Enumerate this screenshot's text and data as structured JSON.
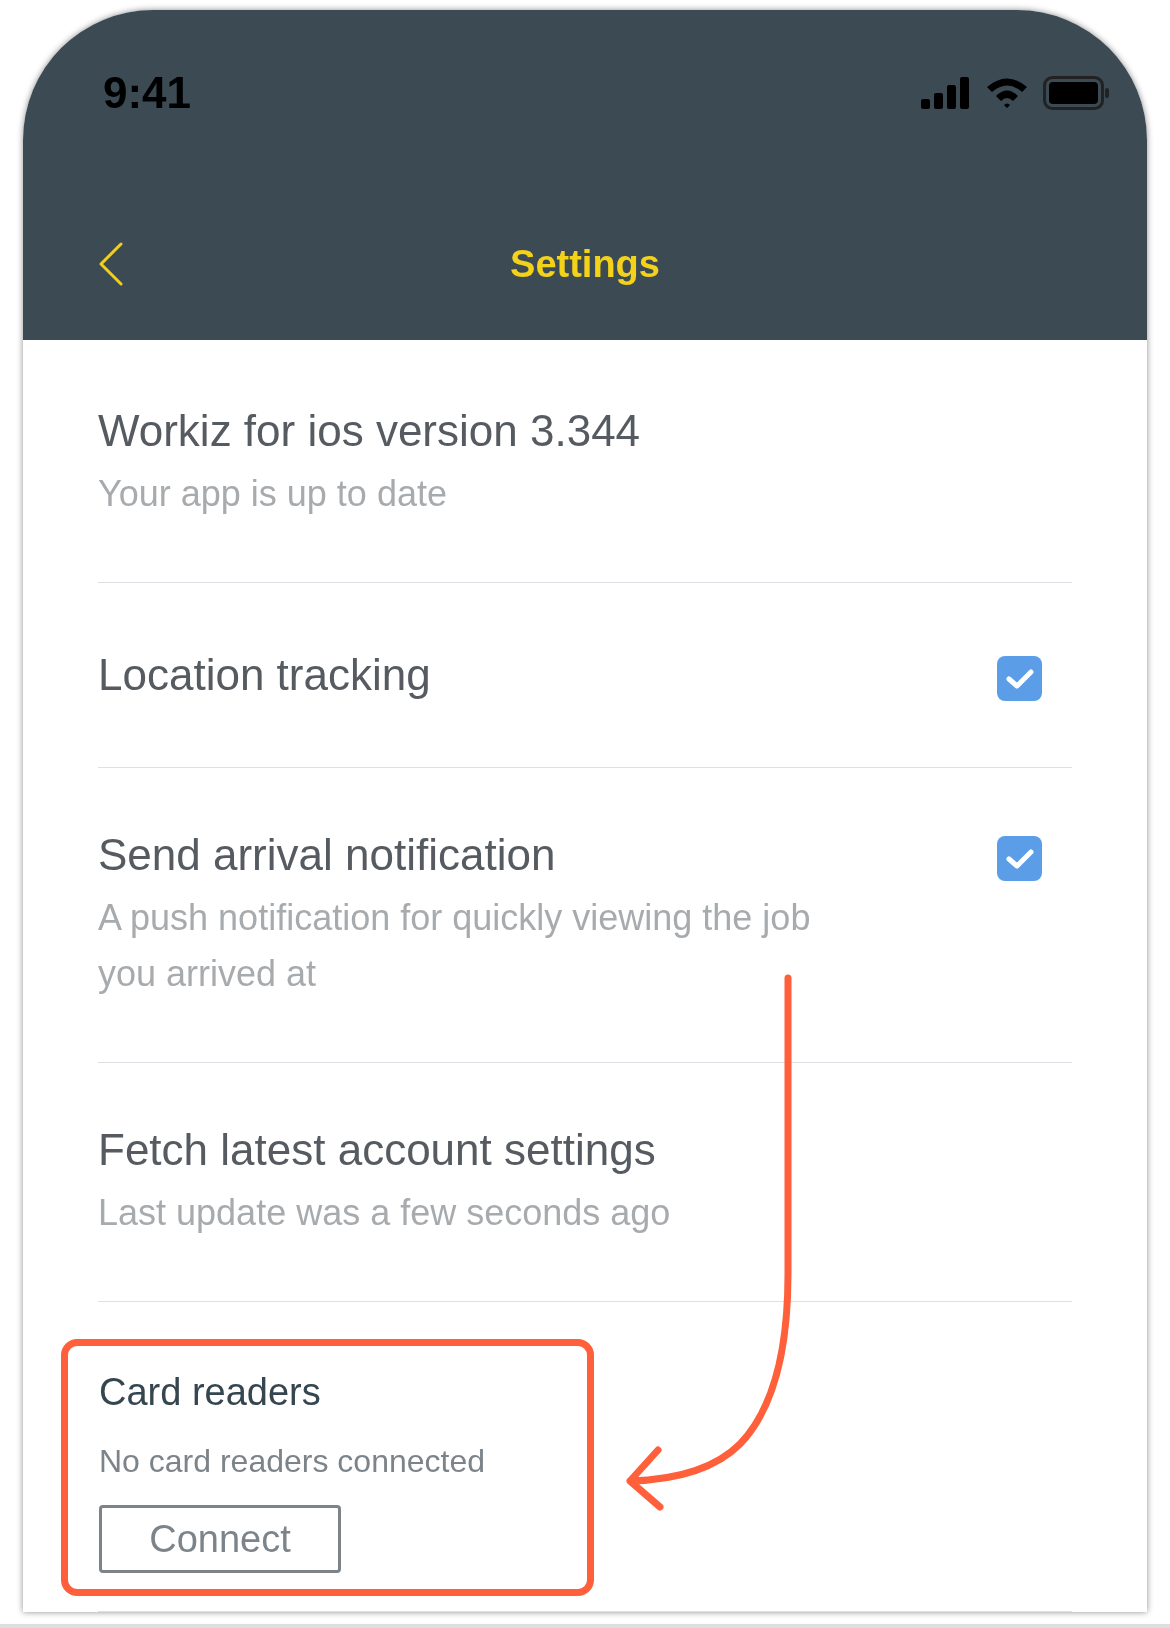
{
  "status_bar": {
    "time": "9:41"
  },
  "header": {
    "title": "Settings"
  },
  "settings": [
    {
      "kind": "info",
      "title": "Workiz for ios version 3.344",
      "subtitle": "Your app is up to date"
    },
    {
      "kind": "checkbox",
      "title": "Location tracking",
      "checked": true
    },
    {
      "kind": "checkbox",
      "title": "Send arrival notification",
      "subtitle": "A push notification for quickly viewing the job you arrived at",
      "checked": true
    },
    {
      "kind": "info",
      "title": "Fetch latest account settings",
      "subtitle": "Last update was a few seconds ago"
    }
  ],
  "card_readers": {
    "heading": "Card readers",
    "status": "No card readers connected",
    "button": "Connect",
    "highlighted": true
  }
}
